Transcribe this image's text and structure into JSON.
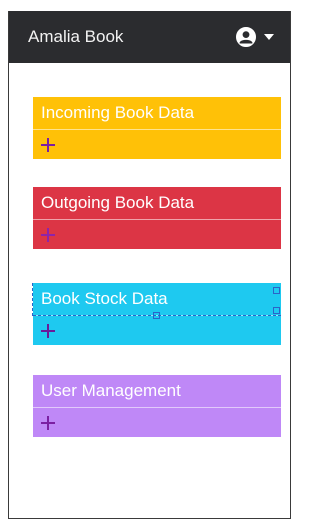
{
  "navbar": {
    "brand": "Amalia Book",
    "user_icon": "user-circle-icon",
    "dropdown_icon": "caret-down-icon"
  },
  "cards": [
    {
      "title": "Incoming Book Data",
      "add_icon": "plus-icon",
      "color": "#ffc107",
      "plus_color": "#7b1fa2"
    },
    {
      "title": "Outgoing Book Data",
      "add_icon": "plus-icon",
      "color": "#dc3545",
      "plus_color": "#8e24aa"
    },
    {
      "title": "Book Stock Data",
      "add_icon": "plus-icon",
      "color": "#1ec9f0",
      "plus_color": "#6a1b9a"
    },
    {
      "title": "User Management",
      "add_icon": "plus-icon",
      "color": "#bf88f7",
      "plus_color": "#7b1fa2"
    }
  ]
}
